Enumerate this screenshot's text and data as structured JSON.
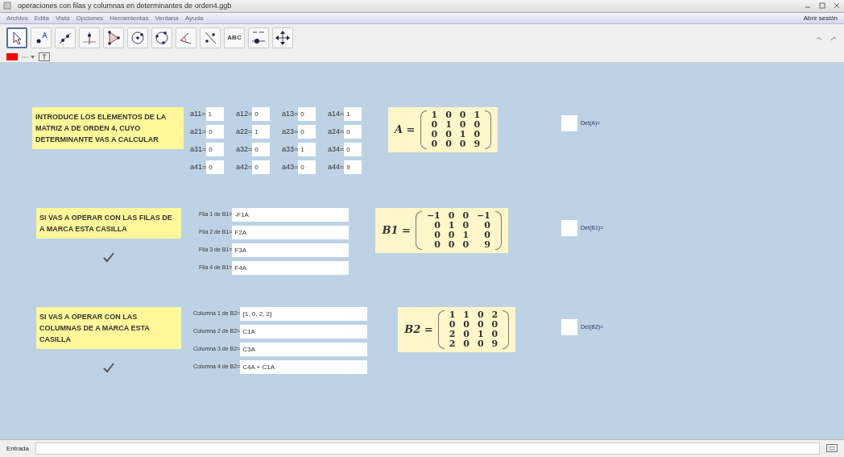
{
  "window": {
    "title": "operaciones con filas y columnas en determinantes de orden4.ggb"
  },
  "menu": [
    "Archivo",
    "Edita",
    "Vista",
    "Opciones",
    "Herramientas",
    "Ventana",
    "Ayuda"
  ],
  "session_link": "Abrir sesión",
  "toolbar": [
    {
      "kind": "move",
      "selected": true
    },
    {
      "kind": "point",
      "selected": false
    },
    {
      "kind": "line",
      "selected": false
    },
    {
      "kind": "perpendicular",
      "selected": false
    },
    {
      "kind": "polygon",
      "selected": false
    },
    {
      "kind": "circle",
      "selected": false
    },
    {
      "kind": "circle3",
      "selected": false
    },
    {
      "kind": "angle",
      "selected": false
    },
    {
      "kind": "reflect",
      "selected": false
    },
    {
      "kind": "text",
      "label": "ABC",
      "selected": false
    },
    {
      "kind": "slider",
      "selected": false
    },
    {
      "kind": "pan",
      "selected": false
    }
  ],
  "style_bar": {
    "color": "#ff0000"
  },
  "sections": [
    {
      "label": "INTRODUCE LOS ELEMENTOS DE LA MATRIZ A DE ORDEN 4, CUYO DETERMINANTE VAS A CALCULAR",
      "kind": "grid",
      "fields": [
        {
          "label": "a11=",
          "value": "1"
        },
        {
          "label": "a12=",
          "value": "0"
        },
        {
          "label": "a13=",
          "value": "0"
        },
        {
          "label": "a14=",
          "value": "1"
        },
        {
          "label": "a21=",
          "value": "0"
        },
        {
          "label": "a22=",
          "value": "1"
        },
        {
          "label": "a23=",
          "value": "0"
        },
        {
          "label": "a24=",
          "value": "0"
        },
        {
          "label": "a31=",
          "value": "0"
        },
        {
          "label": "a32=",
          "value": "0"
        },
        {
          "label": "a33=",
          "value": "1"
        },
        {
          "label": "a34=",
          "value": "0"
        },
        {
          "label": "a41=",
          "value": "0"
        },
        {
          "label": "a42=",
          "value": "0"
        },
        {
          "label": "a43=",
          "value": "0"
        },
        {
          "label": "a44=",
          "value": "9"
        }
      ],
      "matrix": {
        "name": "A =",
        "rows": [
          [
            "1",
            "0",
            "0",
            "1"
          ],
          [
            "0",
            "1",
            "0",
            "0"
          ],
          [
            "0",
            "0",
            "1",
            "0"
          ],
          [
            "0",
            "0",
            "0",
            "9"
          ]
        ]
      },
      "det": {
        "label": "Det(A)=",
        "checked": false
      }
    },
    {
      "label": "SI VAS A OPERAR CON LAS FILAS DE  A MARCA ESTA CASILLA",
      "kind": "list",
      "checked": true,
      "fields": [
        {
          "label": "Fila 1 de B1=",
          "value": "-F1A"
        },
        {
          "label": "Fila 2 de B1=",
          "value": "F2A"
        },
        {
          "label": "Fila 3 de B1=",
          "value": "F3A"
        },
        {
          "label": "Fila 4 de B1=",
          "value": "F4A"
        }
      ],
      "matrix": {
        "name": "B1 =",
        "rows": [
          [
            "−1",
            "0",
            "0",
            "−1"
          ],
          [
            "0",
            "1",
            "0",
            "0"
          ],
          [
            "0",
            "0",
            "1",
            "0"
          ],
          [
            "0",
            "0",
            "0",
            "9"
          ]
        ]
      },
      "det": {
        "label": "Det(B1)=",
        "checked": false
      }
    },
    {
      "label": "SI VAS A OPERAR CON LAS COLUMNAS DE  A MARCA ESTA CASILLA",
      "kind": "list",
      "checked": true,
      "fields": [
        {
          "label": "Columna 1 de B2=",
          "value": "{1, 0, 2, 2}"
        },
        {
          "label": "Columna 2 de B2=",
          "value": "C1A"
        },
        {
          "label": "Columna 3 de B2=",
          "value": "C3A"
        },
        {
          "label": "Columna 4 de B2=",
          "value": "C4A + C1A"
        }
      ],
      "matrix": {
        "name": "B2 =",
        "rows": [
          [
            "1",
            "1",
            "0",
            "2"
          ],
          [
            "0",
            "0",
            "0",
            "0"
          ],
          [
            "2",
            "0",
            "1",
            "0"
          ],
          [
            "2",
            "0",
            "0",
            "9"
          ]
        ]
      },
      "det": {
        "label": "Det(B2)=",
        "checked": false
      }
    }
  ],
  "input_bar": {
    "label": "Entrada"
  }
}
